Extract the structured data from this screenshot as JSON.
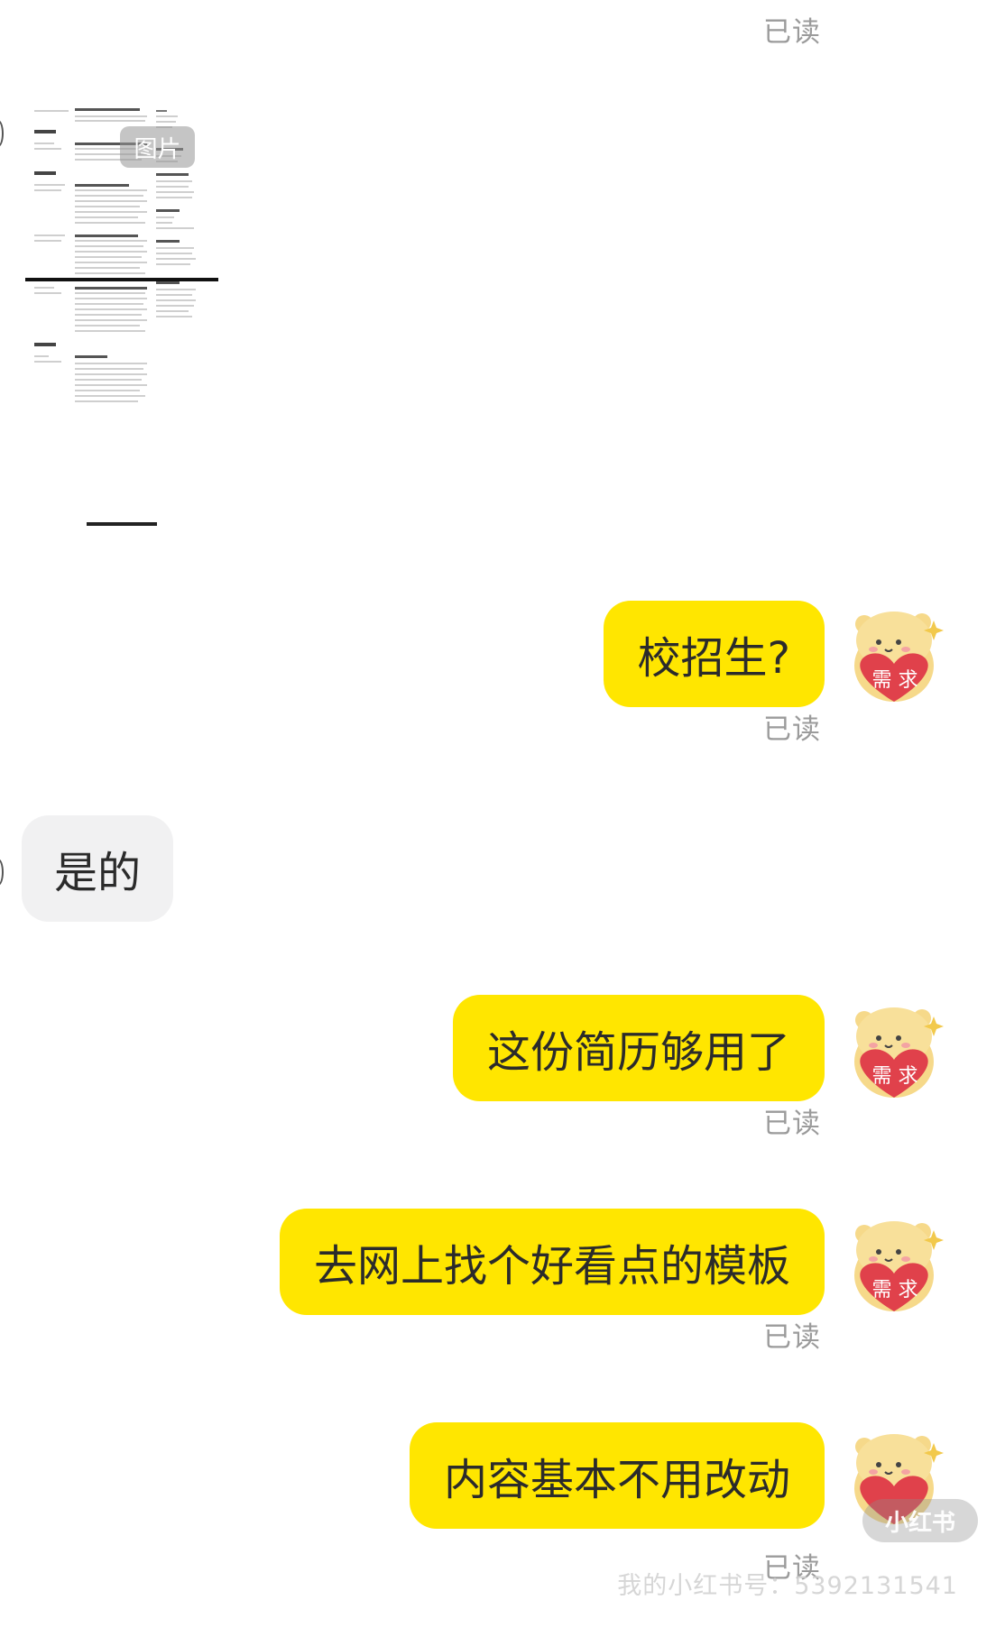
{
  "status": {
    "read": "已读"
  },
  "image_message": {
    "badge": "图片"
  },
  "messages": [
    {
      "sender": "me",
      "text": "校招生?"
    },
    {
      "sender": "other",
      "text": "是的"
    },
    {
      "sender": "me",
      "text": "这份简历够用了"
    },
    {
      "sender": "me",
      "text": "去网上找个好看点的模板"
    },
    {
      "sender": "me",
      "text": "内容基本不用改动"
    }
  ],
  "avatar": {
    "heart_text": "需 求",
    "icon": "bear-avatar-icon"
  },
  "watermark": {
    "logo": "小红书",
    "id": "我的小红书号：5392131541"
  },
  "colors": {
    "my_bubble": "#ffe600",
    "their_bubble": "#f1f1f2",
    "read_text": "#9b9b9b",
    "heart": "#e0414b",
    "bear": "#f6d98a"
  }
}
